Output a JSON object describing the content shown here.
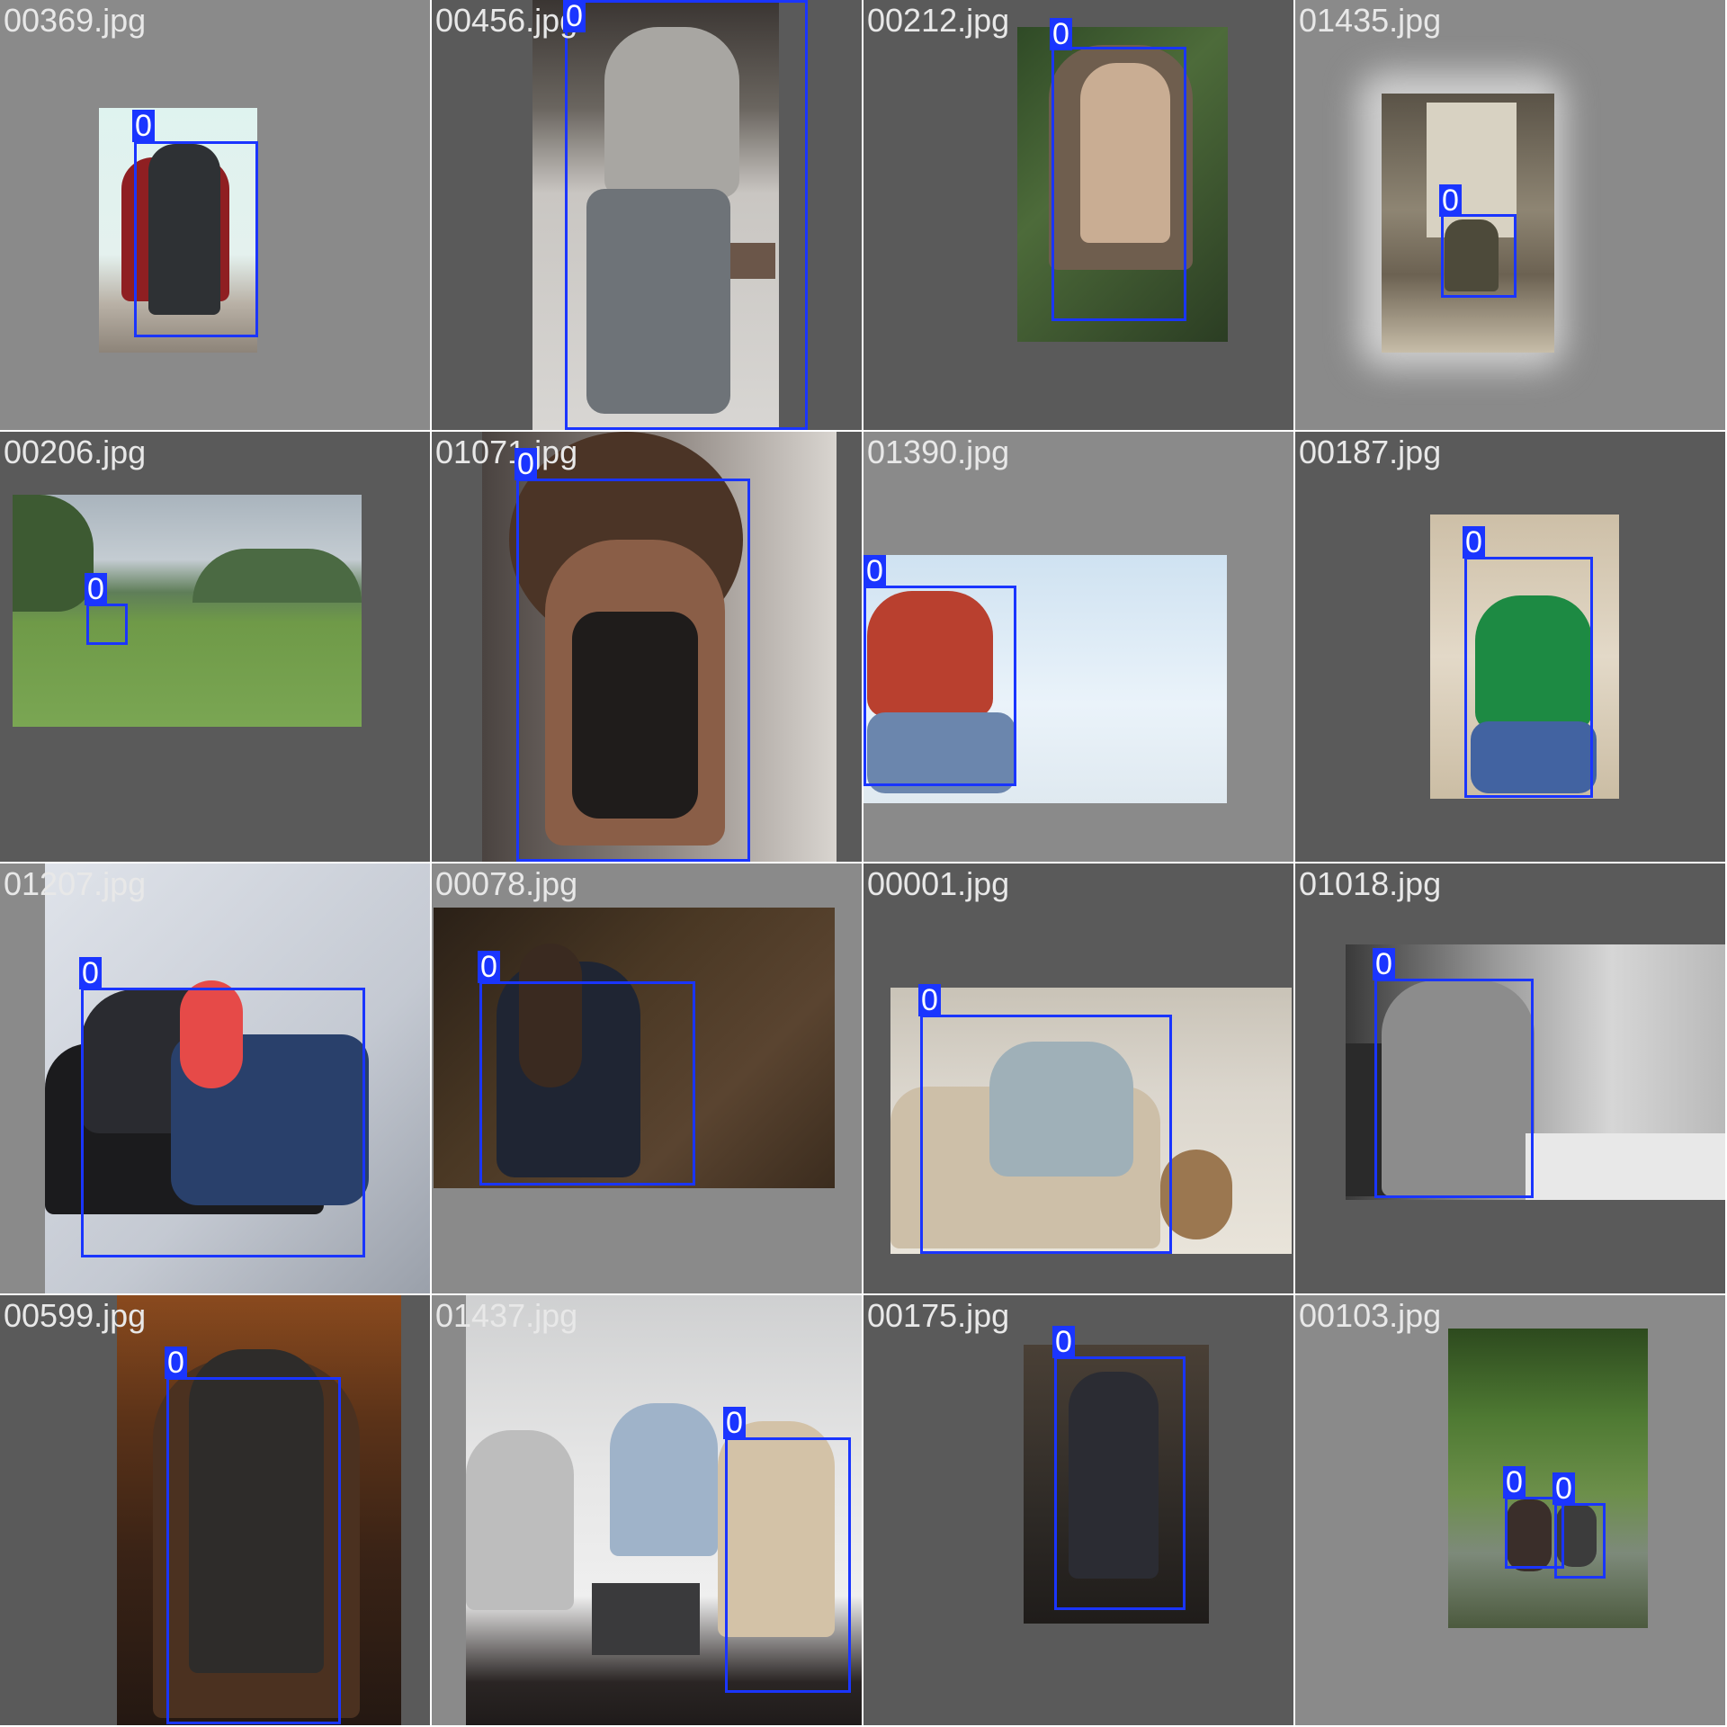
{
  "grid": {
    "tiles": [
      {
        "filename": "00369.jpg",
        "boxes": [
          {
            "label": "0"
          }
        ]
      },
      {
        "filename": "00456.jpg",
        "boxes": [
          {
            "label": "0"
          }
        ]
      },
      {
        "filename": "00212.jpg",
        "boxes": [
          {
            "label": "0"
          }
        ]
      },
      {
        "filename": "01435.jpg",
        "boxes": [
          {
            "label": "0"
          }
        ]
      },
      {
        "filename": "00206.jpg",
        "boxes": [
          {
            "label": "0"
          }
        ]
      },
      {
        "filename": "01071.jpg",
        "boxes": [
          {
            "label": "0"
          }
        ]
      },
      {
        "filename": "01390.jpg",
        "boxes": [
          {
            "label": "0"
          }
        ]
      },
      {
        "filename": "00187.jpg",
        "boxes": [
          {
            "label": "0"
          }
        ]
      },
      {
        "filename": "01207.jpg",
        "boxes": [
          {
            "label": "0"
          }
        ]
      },
      {
        "filename": "00078.jpg",
        "boxes": [
          {
            "label": "0"
          }
        ]
      },
      {
        "filename": "00001.jpg",
        "boxes": [
          {
            "label": "0"
          }
        ]
      },
      {
        "filename": "01018.jpg",
        "boxes": [
          {
            "label": "0"
          }
        ]
      },
      {
        "filename": "00599.jpg",
        "boxes": [
          {
            "label": "0"
          }
        ]
      },
      {
        "filename": "01437.jpg",
        "boxes": [
          {
            "label": "0"
          }
        ]
      },
      {
        "filename": "00175.jpg",
        "boxes": [
          {
            "label": "0"
          }
        ]
      },
      {
        "filename": "00103.jpg",
        "boxes": [
          {
            "label": "0"
          },
          {
            "label": "0"
          }
        ]
      }
    ]
  },
  "colors": {
    "box": "#1a35ff",
    "label_text": "#ffffff",
    "filename_text": "#e8e8e8"
  }
}
